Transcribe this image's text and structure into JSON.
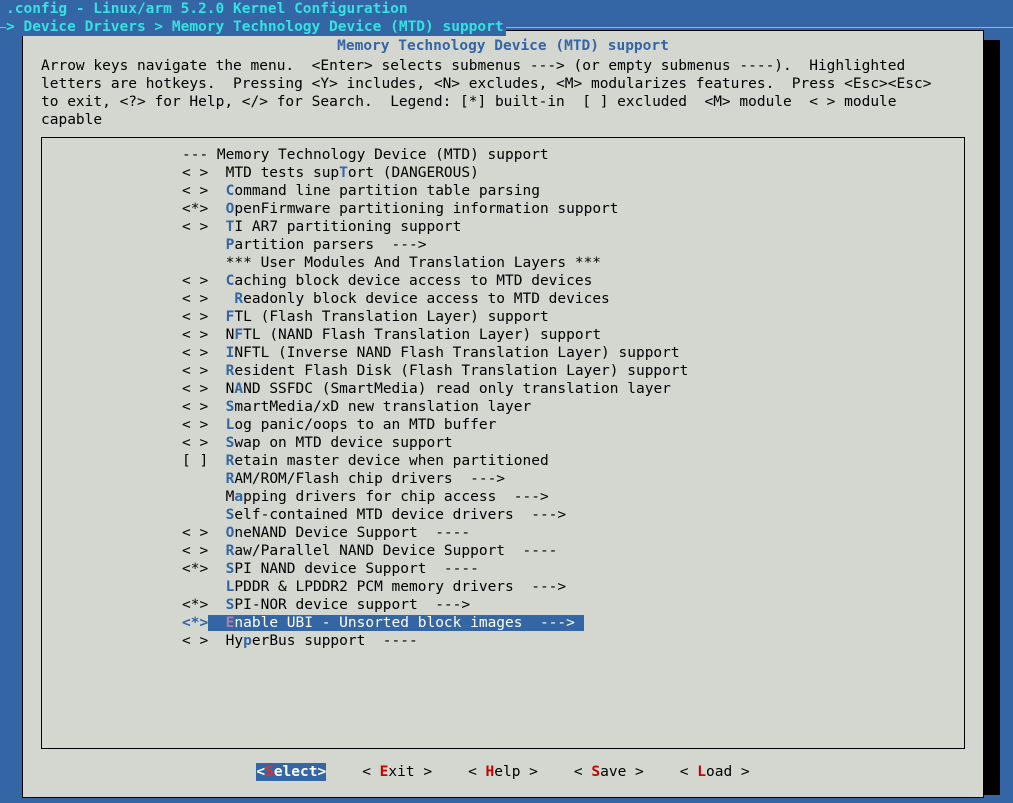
{
  "header": ".config - Linux/arm 5.2.0 Kernel Configuration",
  "breadcrumb": "> Device Drivers > Memory Technology Device (MTD) support",
  "dialog_title": "Memory Technology Device (MTD) support",
  "help_text": "Arrow keys navigate the menu.  <Enter> selects submenus ---> (or empty submenus ----).  Highlighted\nletters are hotkeys.  Pressing <Y> includes, <N> excludes, <M> modularizes features.  Press <Esc><Esc>\nto exit, <?> for Help, </> for Search.  Legend: [*] built-in  [ ] excluded  <M> module  < > module\ncapable",
  "menu": [
    {
      "sel": "---",
      "pre": "",
      "hk": "",
      "text": "Memory Technology Device (MTD) support"
    },
    {
      "sel": "< >",
      "pre": "  MTD tests support (DANGEROUS)",
      "hk": "T",
      "hkpos": 15
    },
    {
      "sel": "< >",
      "pre": "  ",
      "hk": "C",
      "text": "ommand line partition table parsing"
    },
    {
      "sel": "<*>",
      "pre": "  ",
      "hk": "O",
      "text": "penFirmware partitioning information support"
    },
    {
      "sel": "< >",
      "pre": "  ",
      "hk": "T",
      "text": "I AR7 partitioning support"
    },
    {
      "sel": "   ",
      "pre": "  ",
      "hk": "P",
      "text": "artition parsers  --->"
    },
    {
      "sel": "   ",
      "pre": "  *** User Modules And Translation Layers ***"
    },
    {
      "sel": "< >",
      "pre": "  ",
      "hk": "C",
      "text": "aching block device access to MTD devices"
    },
    {
      "sel": "< >",
      "pre": "   ",
      "hk": "R",
      "text": "eadonly block device access to MTD devices"
    },
    {
      "sel": "< >",
      "pre": "  ",
      "hk": "F",
      "text": "TL (Flash Translation Layer) support"
    },
    {
      "sel": "< >",
      "pre": "  N",
      "hk": "F",
      "text": "TL (NAND Flash Translation Layer) support"
    },
    {
      "sel": "< >",
      "pre": "  ",
      "hk": "I",
      "text": "NFTL (Inverse NAND Flash Translation Layer) support"
    },
    {
      "sel": "< >",
      "pre": "  ",
      "hk": "R",
      "text": "esident Flash Disk (Flash Translation Layer) support"
    },
    {
      "sel": "< >",
      "pre": "  N",
      "hk": "A",
      "text": "ND SSFDC (SmartMedia) read only translation layer"
    },
    {
      "sel": "< >",
      "pre": "  ",
      "hk": "S",
      "text": "martMedia/xD new translation layer"
    },
    {
      "sel": "< >",
      "pre": "  ",
      "hk": "L",
      "text": "og panic/oops to an MTD buffer"
    },
    {
      "sel": "< >",
      "pre": "  ",
      "hk": "S",
      "text": "wap on MTD device support"
    },
    {
      "sel": "[ ]",
      "pre": "  ",
      "hk": "R",
      "text": "etain master device when partitioned"
    },
    {
      "sel": "   ",
      "pre": "  ",
      "hk": "R",
      "text": "AM/ROM/Flash chip drivers  --->"
    },
    {
      "sel": "   ",
      "pre": "  M",
      "hk": "a",
      "text": "pping drivers for chip access  --->"
    },
    {
      "sel": "   ",
      "pre": "  ",
      "hk": "S",
      "text": "elf-contained MTD device drivers  --->"
    },
    {
      "sel": "< >",
      "pre": "  ",
      "hk": "O",
      "text": "neNAND Device Support  ----"
    },
    {
      "sel": "< >",
      "pre": "  ",
      "hk": "R",
      "text": "aw/Parallel NAND Device Support  ----"
    },
    {
      "sel": "<*>",
      "pre": "  ",
      "hk": "S",
      "text": "PI NAND device Support  ----"
    },
    {
      "sel": "   ",
      "pre": "  ",
      "hk": "L",
      "text": "PDDR & LPDDR2 PCM memory drivers  --->"
    },
    {
      "sel": "<*>",
      "pre": "  ",
      "hk": "S",
      "text": "PI-NOR device support  --->"
    },
    {
      "sel": "<*>",
      "pre": "  ",
      "hk": "E",
      "text": "nable UBI - Unsorted block images  ---> ",
      "selected": true
    },
    {
      "sel": "< >",
      "pre": "  Hy",
      "hk": "p",
      "text": "erBus support  ----"
    }
  ],
  "buttons": [
    {
      "label": "Select",
      "hk": "S",
      "selected": true
    },
    {
      "label": "Exit",
      "hk": "E"
    },
    {
      "label": "Help",
      "hk": "H"
    },
    {
      "label": "Save",
      "hk": "S"
    },
    {
      "label": "Load",
      "hk": "L"
    }
  ]
}
